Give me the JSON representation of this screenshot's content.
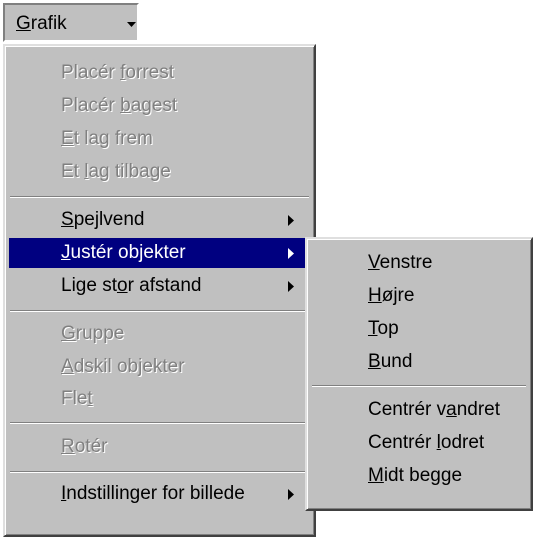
{
  "menubar": {
    "label": "Grafik",
    "label_mnemonic": "G",
    "label_rest": "rafik"
  },
  "main_menu": {
    "items": [
      {
        "pre": "Placér ",
        "u": "f",
        "post": "orrest",
        "disabled": true
      },
      {
        "pre": "Placér ",
        "u": "b",
        "post": "agest",
        "disabled": true
      },
      {
        "pre": "",
        "u": "E",
        "post": "t lag frem",
        "disabled": true
      },
      {
        "pre": "Et ",
        "u": "l",
        "post": "ag tilbage",
        "disabled": true
      },
      {
        "pre": "",
        "u": "S",
        "post": "pejlvend",
        "disabled": false,
        "submenu": true
      },
      {
        "pre": "",
        "u": "J",
        "post": "ustér objekter",
        "disabled": false,
        "submenu": true,
        "selected": true
      },
      {
        "pre": "Lige st",
        "u": "o",
        "post": "r afstand",
        "disabled": false,
        "submenu": true
      },
      {
        "pre": "",
        "u": "G",
        "post": "ruppe",
        "disabled": true
      },
      {
        "pre": "",
        "u": "A",
        "post": "dskil objekter",
        "disabled": true
      },
      {
        "pre": "Fle",
        "u": "t",
        "post": "",
        "disabled": true
      },
      {
        "pre": "",
        "u": "R",
        "post": "otér",
        "disabled": true
      },
      {
        "pre": "",
        "u": "I",
        "post": "ndstillinger for billede",
        "disabled": false,
        "submenu": true
      }
    ]
  },
  "sub_menu": {
    "items": [
      {
        "pre": "",
        "u": "V",
        "post": "enstre"
      },
      {
        "pre": "",
        "u": "H",
        "post": "øjre"
      },
      {
        "pre": "",
        "u": "T",
        "post": "op"
      },
      {
        "pre": "",
        "u": "B",
        "post": "und"
      },
      {
        "pre": "Centrér v",
        "u": "a",
        "post": "ndret"
      },
      {
        "pre": "Centrér ",
        "u": "l",
        "post": "odret"
      },
      {
        "pre": "",
        "u": "M",
        "post": "idt begge"
      }
    ]
  },
  "icons": {
    "dropdown": "chevron-down-icon",
    "submenu": "submenu-arrow-icon"
  },
  "colors": {
    "menu_bg": "#c0c0c0",
    "highlight": "#000080",
    "disabled_text": "#808080"
  }
}
